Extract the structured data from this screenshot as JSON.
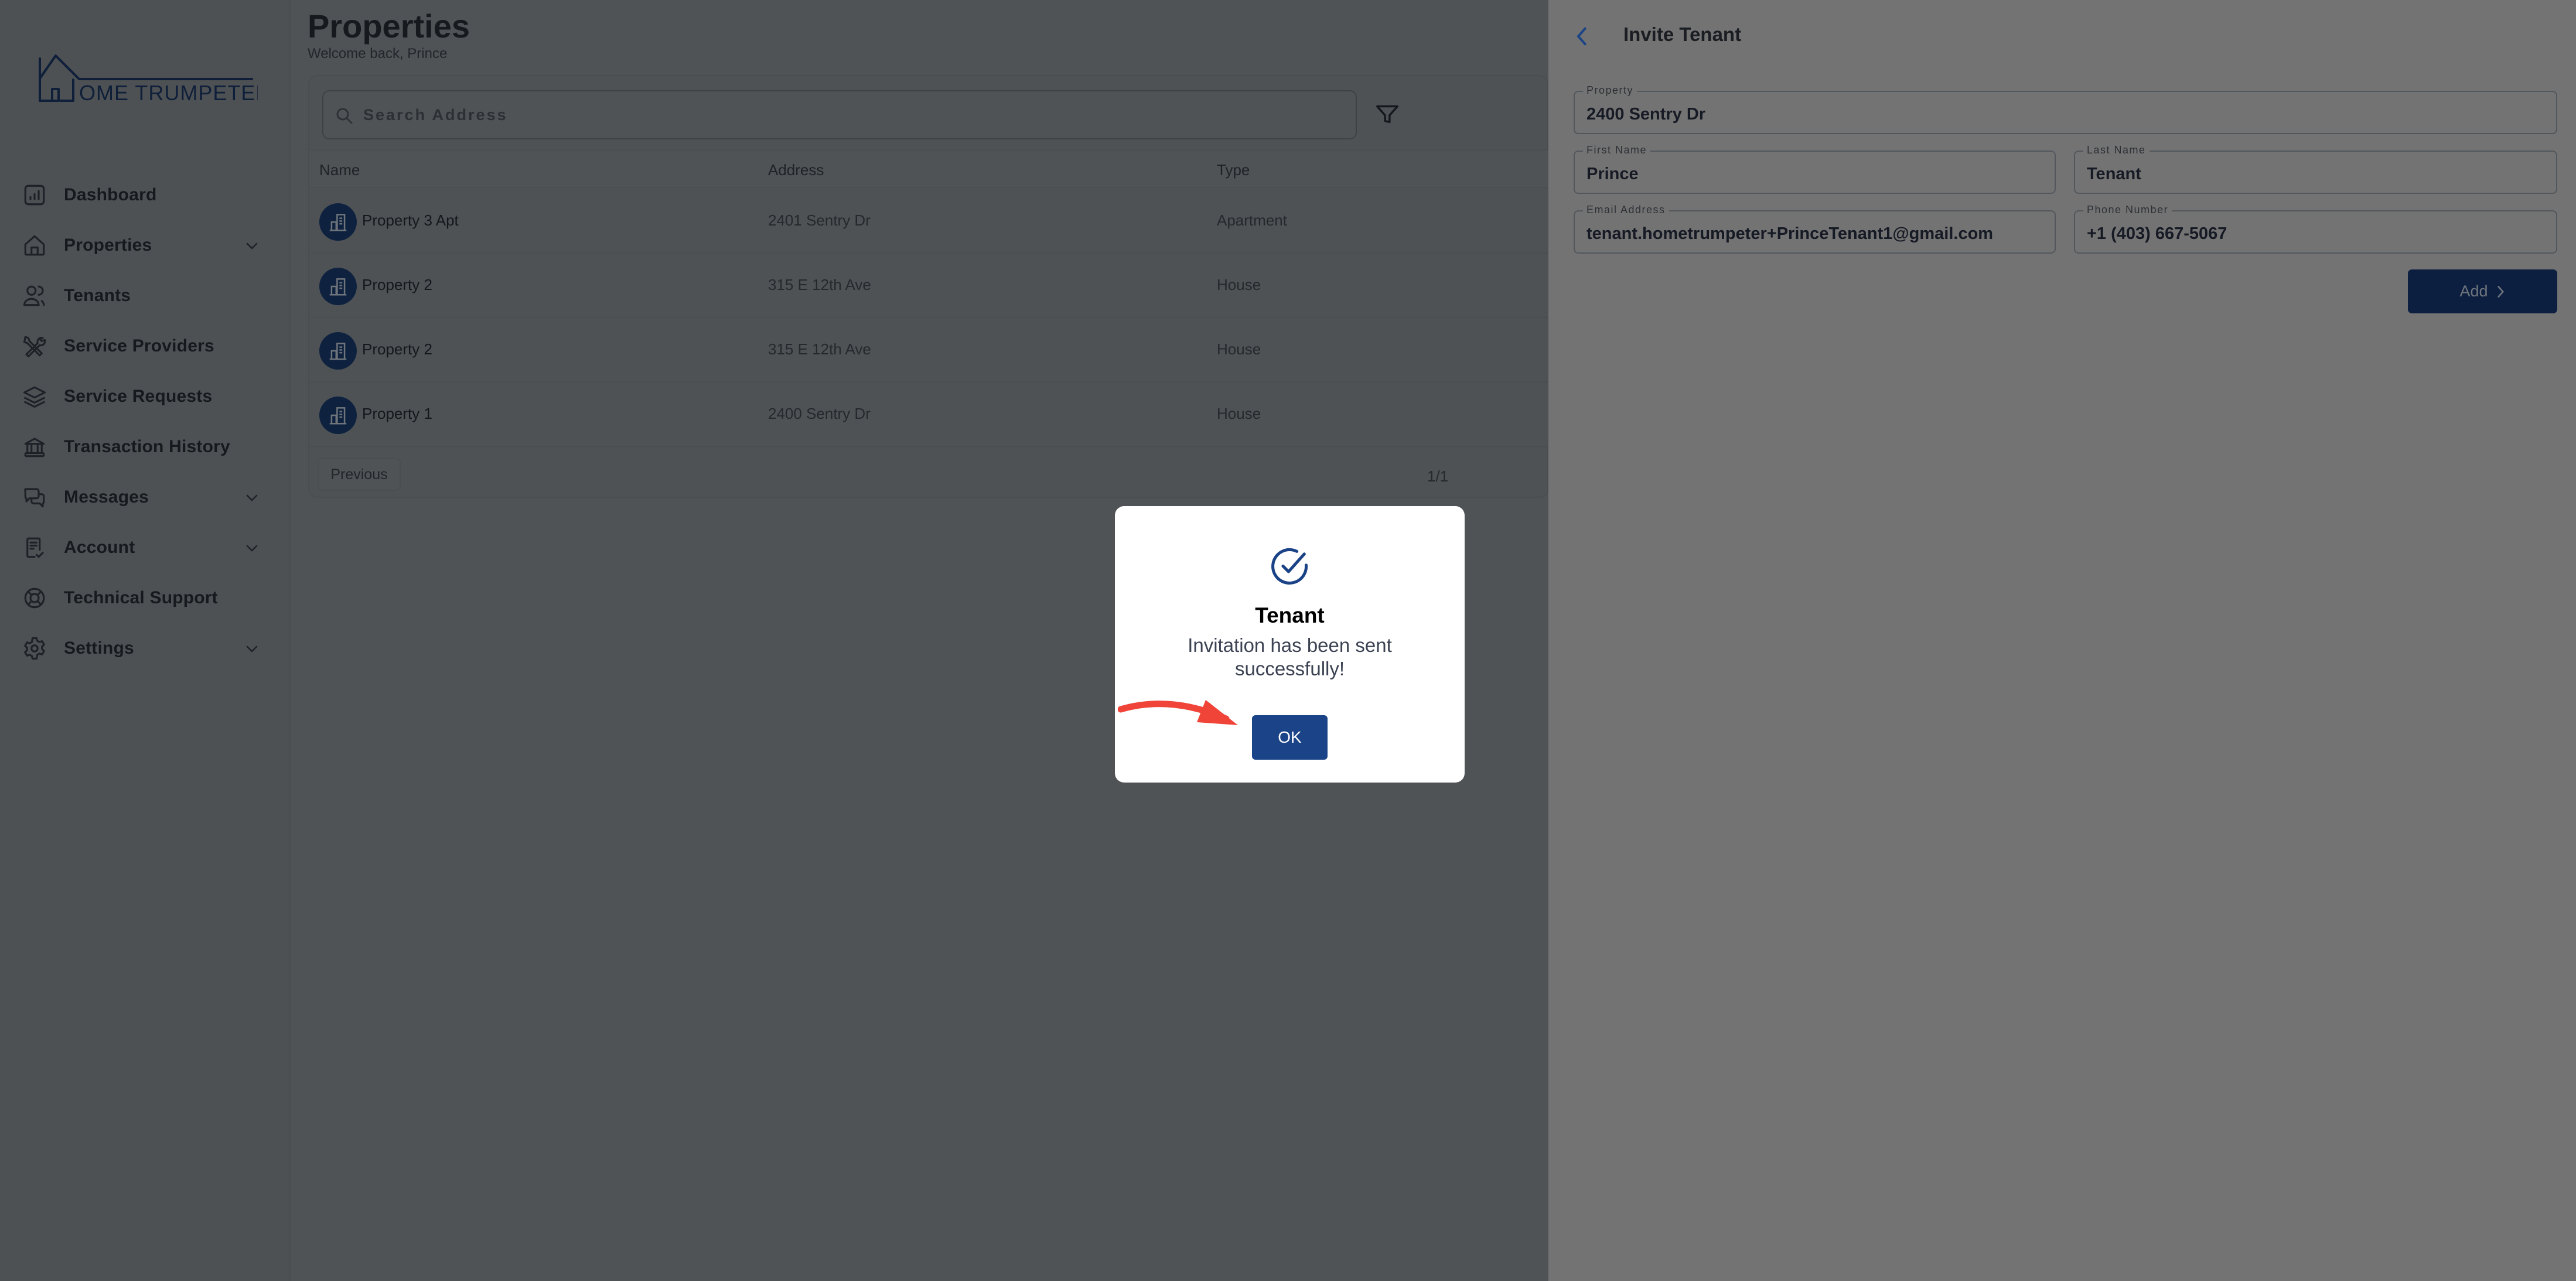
{
  "brand": {
    "logo_text": "OME TRUMPETER"
  },
  "sidebar": {
    "items": [
      {
        "label": "Dashboard",
        "icon": "dashboard-chart-icon",
        "expandable": false
      },
      {
        "label": "Properties",
        "icon": "home-icon",
        "expandable": true
      },
      {
        "label": "Tenants",
        "icon": "users-icon",
        "expandable": false
      },
      {
        "label": "Service Providers",
        "icon": "tools-icon",
        "expandable": false
      },
      {
        "label": "Service Requests",
        "icon": "layers-icon",
        "expandable": false
      },
      {
        "label": "Transaction History",
        "icon": "bank-icon",
        "expandable": false
      },
      {
        "label": "Messages",
        "icon": "messages-icon",
        "expandable": true
      },
      {
        "label": "Account",
        "icon": "document-check-icon",
        "expandable": true
      },
      {
        "label": "Technical Support",
        "icon": "lifebuoy-icon",
        "expandable": false
      },
      {
        "label": "Settings",
        "icon": "gear-icon",
        "expandable": true
      }
    ]
  },
  "main": {
    "title": "Properties",
    "subtitle": "Welcome back, Prince",
    "search": {
      "placeholder": "Search Address",
      "value": ""
    },
    "table": {
      "columns": [
        "Name",
        "Address",
        "Type"
      ],
      "rows": [
        {
          "name": "Property 3 Apt",
          "address": "2401 Sentry Dr",
          "type": "Apartment"
        },
        {
          "name": "Property 2",
          "address": "315 E 12th Ave",
          "type": "House"
        },
        {
          "name": "Property 2",
          "address": "315 E 12th Ave",
          "type": "House"
        },
        {
          "name": "Property 1",
          "address": "2400 Sentry Dr",
          "type": "House"
        }
      ]
    },
    "pagination": {
      "previous_label": "Previous",
      "page_indicator": "1/1"
    }
  },
  "panel": {
    "title": "Invite Tenant",
    "fields": {
      "property": {
        "label": "Property",
        "value": "2400 Sentry Dr"
      },
      "first_name": {
        "label": "First Name",
        "value": "Prince"
      },
      "last_name": {
        "label": "Last Name",
        "value": "Tenant"
      },
      "email": {
        "label": "Email Address",
        "value": "tenant.hometrumpeter+PrinceTenant1@gmail.com"
      },
      "phone": {
        "label": "Phone Number",
        "value": "+1 (403) 667-5067"
      }
    },
    "add_label": "Add"
  },
  "modal": {
    "title": "Tenant",
    "message": "Invitation has been sent successfully!",
    "ok_label": "OK"
  },
  "colors": {
    "brand_navy": "#0e2240",
    "primary_blue": "#1b4387",
    "annotation_red": "#f04438"
  }
}
